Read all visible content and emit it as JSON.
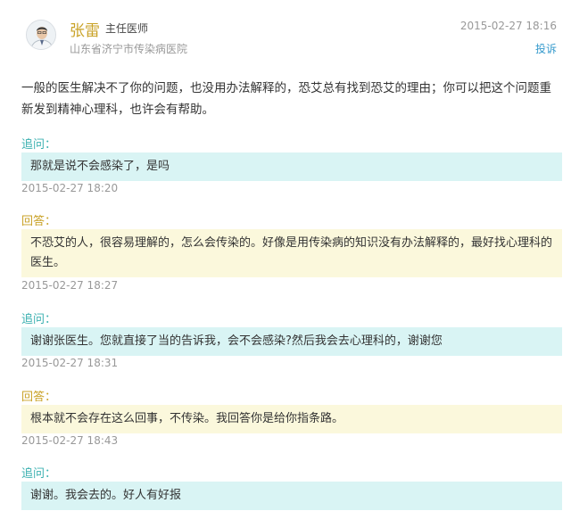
{
  "doctor": {
    "name": "张雷",
    "title": "主任医师",
    "hospital": "山东省济宁市传染病医院",
    "post_time": "2015-02-27 18:16",
    "complain_label": "投诉"
  },
  "answer": "一般的医生解决不了你的问题，也没用办法解释的，恐艾总有找到恐艾的理由；你可以把这个问题重新发到精神心理科，也许会有帮助。",
  "thread": [
    {
      "kind": "q",
      "label": "追问：",
      "text": "那就是说不会感染了，是吗",
      "time": "2015-02-27 18:20"
    },
    {
      "kind": "a",
      "label": "回答：",
      "text": "不恐艾的人，很容易理解的，怎么会传染的。好像是用传染病的知识没有办法解释的，最好找心理科的医生。",
      "time": "2015-02-27 18:27"
    },
    {
      "kind": "q",
      "label": "追问：",
      "text": "谢谢张医生。您就直接了当的告诉我，会不会感染?然后我会去心理科的，谢谢您",
      "time": "2015-02-27 18:31"
    },
    {
      "kind": "a",
      "label": "回答：",
      "text": "根本就不会存在这么回事，不传染。我回答你是给你指条路。",
      "time": "2015-02-27 18:43"
    },
    {
      "kind": "q",
      "label": "追问：",
      "text": "谢谢。我会去的。好人有好报",
      "time": ""
    }
  ]
}
